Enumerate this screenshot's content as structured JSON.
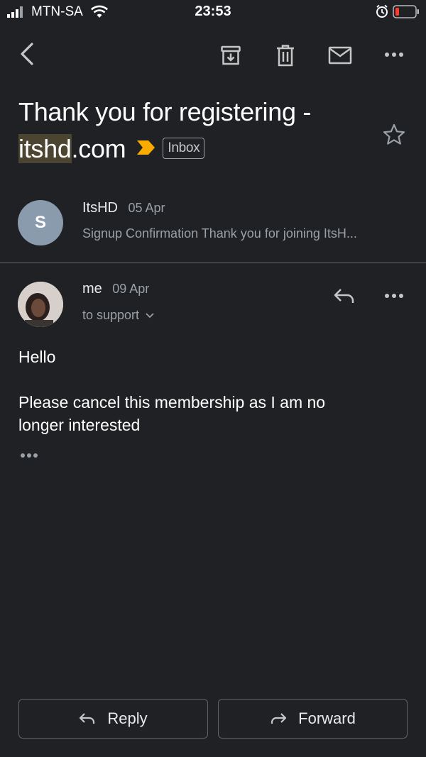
{
  "status_bar": {
    "carrier": "MTN-SA",
    "time": "23:53"
  },
  "toolbar": {
    "back": "back-arrow-icon",
    "archive": "archive-icon",
    "delete": "trash-icon",
    "mark_unread": "mail-icon",
    "more": "more-horizontal-icon"
  },
  "email": {
    "subject_line1": "Thank you for registering -",
    "subject_highlight": "itshd",
    "subject_rest": ".com",
    "label": "Inbox",
    "important_color": "#f9ab00"
  },
  "messages": [
    {
      "avatar_letter": "S",
      "sender": "ItsHD",
      "date": "05 Apr",
      "snippet": "Signup Confirmation Thank you for joining ItsH..."
    },
    {
      "sender": "me",
      "date": "09 Apr",
      "recipient": "to support",
      "body_greeting": "Hello",
      "body_line1": "Please cancel this membership as I am no",
      "body_line2": "longer interested"
    }
  ],
  "actions": {
    "reply": "Reply",
    "forward": "Forward"
  }
}
